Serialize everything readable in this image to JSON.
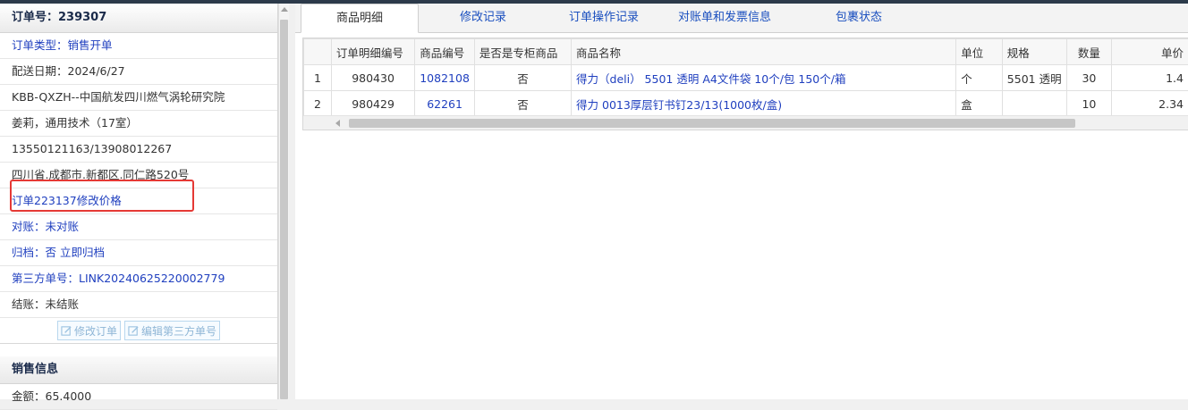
{
  "left": {
    "header": "订单号：239307",
    "rows": [
      {
        "label": "订单类型：",
        "value": "销售开单"
      },
      {
        "label": "配送日期：",
        "value": "2024/6/27"
      },
      {
        "label": "",
        "value": "KBB-QXZH--中国航发四川燃气涡轮研究院"
      },
      {
        "label": "",
        "value": "姜莉，通用技术（17室）"
      },
      {
        "label": "",
        "value": "13550121163/13908012267"
      },
      {
        "label": "",
        "value": "四川省.成都市.新都区.同仁路520号"
      },
      {
        "label": "",
        "value": "订单223137修改价格"
      },
      {
        "label": "对账：",
        "value": "未对账"
      },
      {
        "label": "归档：",
        "value": "否 立即归档"
      },
      {
        "label": "第三方单号：",
        "value": "LINK20240625220002779"
      },
      {
        "label": "结账：",
        "value": "未结账"
      }
    ],
    "buttons": {
      "edit_order": "修改订单",
      "edit_third": "编辑第三方单号"
    },
    "sales_header": "销售信息",
    "amount": {
      "label": "金额：",
      "value": "65.4000"
    }
  },
  "tabs": [
    "商品明细",
    "修改记录",
    "订单操作记录",
    "对账单和发票信息",
    "包裹状态"
  ],
  "table": {
    "headers": [
      "",
      "订单明细编号",
      "商品编号",
      "是否是专柜商品",
      "商品名称",
      "单位",
      "规格",
      "数量",
      "单价"
    ],
    "rows": [
      [
        "1",
        "980430",
        "1082108",
        "否",
        "得力（deli） 5501 透明 A4文件袋 10个/包 150个/箱",
        "个",
        "5501 透明",
        "30",
        "1.4"
      ],
      [
        "2",
        "980429",
        "62261",
        "否",
        "得力 0013厚层钉书钉23/13(1000枚/盒)",
        "盒",
        "",
        "10",
        "2.34"
      ]
    ]
  },
  "colors": {
    "link": "#1f3fbf",
    "highlight": "#e53935"
  }
}
